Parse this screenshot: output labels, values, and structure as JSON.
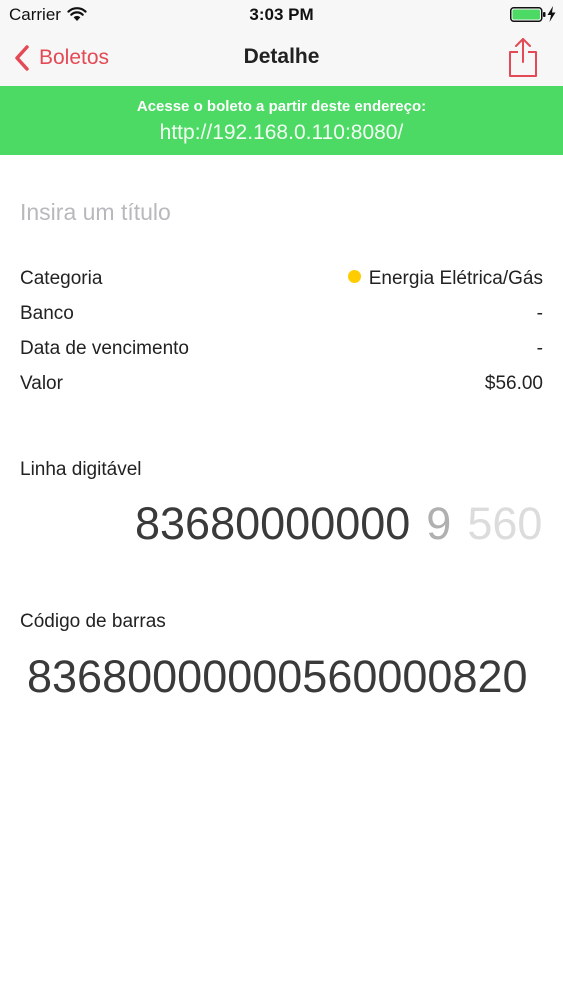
{
  "status_bar": {
    "carrier": "Carrier",
    "time": "3:03 PM"
  },
  "nav": {
    "back_label": "Boletos",
    "title": "Detalhe"
  },
  "banner": {
    "caption": "Acesse o boleto a partir deste endereço:",
    "url": "http://192.168.0.110:8080/"
  },
  "form": {
    "title_placeholder": "Insira um título",
    "title_value": ""
  },
  "details": {
    "category": {
      "label": "Categoria",
      "value": "Energia Elétrica/Gás"
    },
    "bank": {
      "label": "Banco",
      "value": "-"
    },
    "due_date": {
      "label": "Data de vencimento",
      "value": "-"
    },
    "amount": {
      "label": "Valor",
      "value": "$56.00"
    }
  },
  "digitable_line": {
    "label": "Linha digitável",
    "segments": [
      "83680000000",
      "9",
      "560"
    ]
  },
  "barcode": {
    "label": "Código de barras",
    "value": "83680000000560000820"
  },
  "colors": {
    "accent_red": "#e34a56",
    "banner_green": "#4cd964",
    "category_dot": "#ffcc00",
    "battery_green": "#4cd964"
  },
  "icons": {
    "back": "chevron-left-icon",
    "share": "share-icon",
    "wifi": "wifi-icon",
    "battery": "battery-icon",
    "charging": "bolt-icon",
    "category": "category-dot-icon"
  }
}
